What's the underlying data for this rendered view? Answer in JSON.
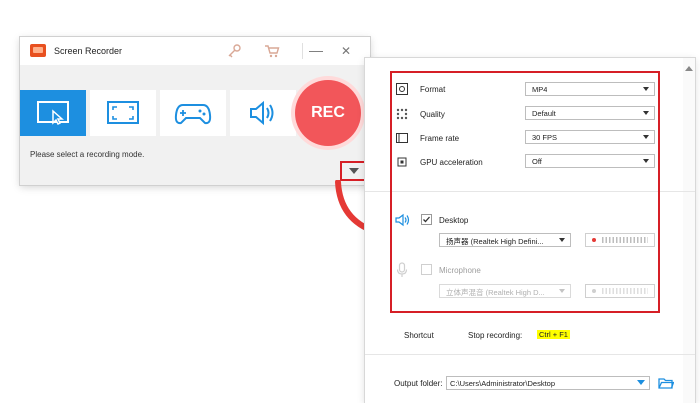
{
  "recorder": {
    "title": "Screen Recorder",
    "minimize_glyph": "—",
    "close_glyph": "✕",
    "modes": [
      {
        "icon": "region-select-icon",
        "active": true
      },
      {
        "icon": "fullscreen-icon",
        "active": false
      },
      {
        "icon": "gamepad-icon",
        "active": false
      },
      {
        "icon": "speaker-icon",
        "active": false
      }
    ],
    "rec_label": "REC",
    "prompt": "Please select a recording mode."
  },
  "settings": {
    "rows": [
      {
        "label": "Format",
        "value": "MP4",
        "icon": "format-gear-icon"
      },
      {
        "label": "Quality",
        "value": "Default",
        "icon": "quality-dots-icon"
      },
      {
        "label": "Frame rate",
        "value": "30 FPS",
        "icon": "film-frame-icon"
      },
      {
        "label": "GPU acceleration",
        "value": "Off",
        "icon": "gpu-chip-icon"
      }
    ],
    "desktop": {
      "label": "Desktop",
      "checked": true,
      "device": "扬声器 (Realtek High Defini...",
      "icon": "speaker-icon"
    },
    "microphone": {
      "label": "Microphone",
      "checked": false,
      "device": "立体声混音 (Realtek High D...",
      "icon": "microphone-icon"
    },
    "shortcut_label": "Shortcut",
    "stop_label": "Stop recording:",
    "stop_key": "Ctrl + F1",
    "output_label": "Output folder:",
    "output_path": "C:\\Users\\Administrator\\Desktop"
  },
  "colors": {
    "accent": "#1d8fe0",
    "rec": "#f2565a",
    "highlight": "#d61f26",
    "level_active": "#e53935"
  }
}
